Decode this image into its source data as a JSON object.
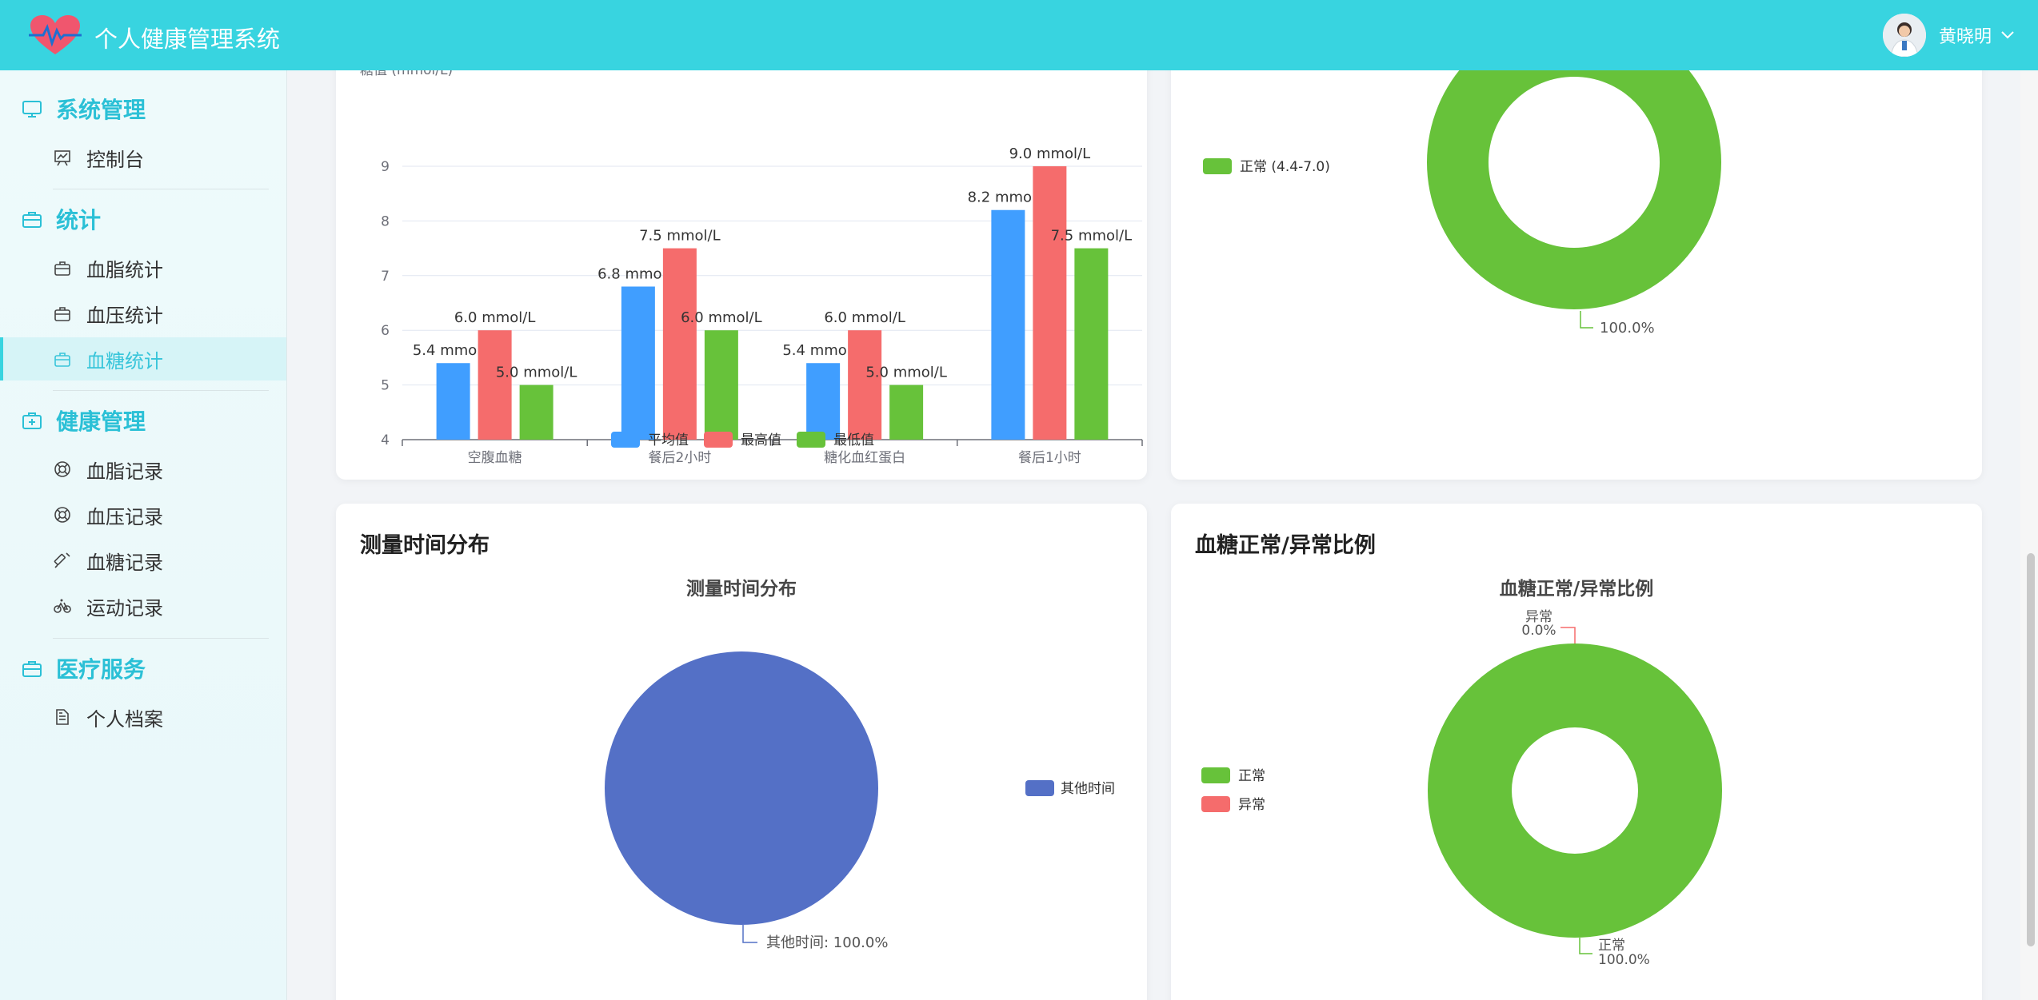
{
  "header": {
    "app_title": "个人健康管理系统",
    "user_name": "黄晓明",
    "logo_icon": "heart-pulse-icon",
    "brand_color": "#38d4e0"
  },
  "sidebar": {
    "sections": [
      {
        "title": "系统管理",
        "icon": "monitor-icon",
        "items": [
          {
            "label": "控制台",
            "icon": "chart-board-icon"
          }
        ]
      },
      {
        "title": "统计",
        "icon": "briefcase-icon",
        "items": [
          {
            "label": "血脂统计",
            "icon": "briefcase-icon"
          },
          {
            "label": "血压统计",
            "icon": "briefcase-icon"
          },
          {
            "label": "血糖统计",
            "icon": "briefcase-icon",
            "active": true
          }
        ]
      },
      {
        "title": "健康管理",
        "icon": "medical-kit-icon",
        "items": [
          {
            "label": "血脂记录",
            "icon": "lifebuoy-icon"
          },
          {
            "label": "血压记录",
            "icon": "lifebuoy-icon"
          },
          {
            "label": "血糖记录",
            "icon": "syringe-icon"
          },
          {
            "label": "运动记录",
            "icon": "bicycle-icon"
          }
        ]
      },
      {
        "title": "医疗服务",
        "icon": "briefcase-icon",
        "items": [
          {
            "label": "个人档案",
            "icon": "document-icon"
          }
        ]
      }
    ]
  },
  "cards": {
    "bar": {
      "ylabel": "糖值 (mmol/L)"
    },
    "top_right_donut": {
      "legend": "正常 (4.4-7.0)",
      "label": "100.0%"
    },
    "time_dist": {
      "card_title": "测量时间分布",
      "chart_title": "测量时间分布",
      "legend": "其他时间",
      "label": "其他时间: 100.0%"
    },
    "ratio": {
      "card_title": "血糖正常/异常比例",
      "chart_title": "血糖正常/异常比例",
      "legend_normal": "正常",
      "legend_abnormal": "异常",
      "label_abnormal_name": "异常",
      "label_abnormal_value": "0.0%",
      "label_normal_name": "正常",
      "label_normal_value": "100.0%"
    }
  },
  "chart_data": [
    {
      "type": "bar",
      "categories": [
        "空腹血糖",
        "餐后2小时",
        "糖化血红蛋白",
        "餐后1小时"
      ],
      "series": [
        {
          "name": "平均值",
          "values": [
            5.4,
            6.8,
            5.4,
            8.2
          ],
          "color": "#409eff",
          "labels": [
            "5.4 mmol/L",
            "6.8 mmol/L",
            "5.4 mmol/L",
            "8.2 mmol/L"
          ]
        },
        {
          "name": "最高值",
          "values": [
            6.0,
            7.5,
            6.0,
            9.0
          ],
          "color": "#f56c6c",
          "labels": [
            "6.0 mmol/L",
            "7.5 mmol/L",
            "6.0 mmol/L",
            "9.0 mmol/L"
          ]
        },
        {
          "name": "最低值",
          "values": [
            5.0,
            6.0,
            5.0,
            7.5
          ],
          "color": "#67c23a",
          "labels": [
            "5.0 mmol/L",
            "6.0 mmol/L",
            "5.0 mmol/L",
            "7.5 mmol/L"
          ]
        }
      ],
      "ylabel": "糖值 (mmol/L)",
      "ylim": [
        4,
        9
      ],
      "yticks": [
        "4",
        "5",
        "6",
        "7",
        "8",
        "9"
      ],
      "grid": true,
      "legend": "bottom"
    },
    {
      "type": "pie",
      "variant": "donut",
      "slices": [
        {
          "name": "正常 (4.4-7.0)",
          "value": 100.0,
          "color": "#67c23a"
        }
      ],
      "legend": "left"
    },
    {
      "type": "pie",
      "title": "测量时间分布",
      "slices": [
        {
          "name": "其他时间",
          "value": 100.0,
          "color": "#5470c6"
        }
      ],
      "legend": "right"
    },
    {
      "type": "pie",
      "variant": "donut",
      "title": "血糖正常/异常比例",
      "slices": [
        {
          "name": "正常",
          "value": 100.0,
          "color": "#67c23a"
        },
        {
          "name": "异常",
          "value": 0.0,
          "color": "#f56c6c"
        }
      ],
      "legend": "left"
    }
  ]
}
